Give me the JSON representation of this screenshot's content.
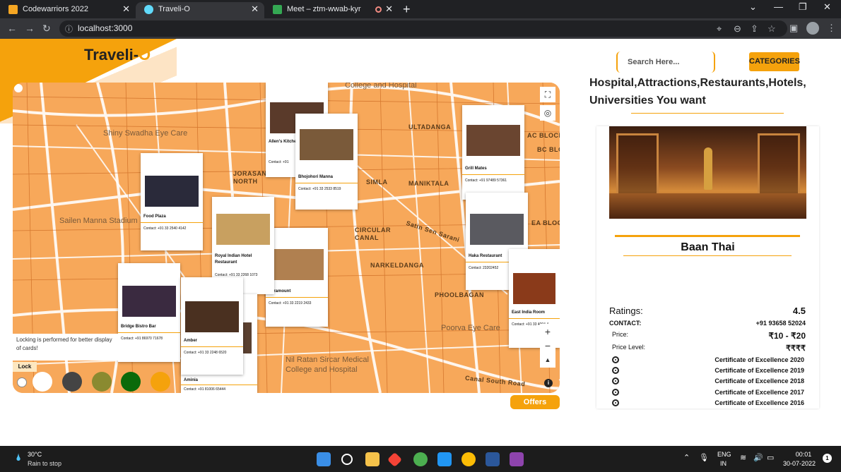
{
  "browser": {
    "tabs": [
      {
        "title": "Codewarriors 2022",
        "favicon_color": "#f5a623",
        "active": false
      },
      {
        "title": "Traveli-O",
        "favicon_color": "#61dafb",
        "active": true
      },
      {
        "title": "Meet – ztm-wwab-kyr",
        "favicon_color": "#34a853",
        "active": false
      }
    ],
    "new_tab": "+",
    "url": "localhost:3000"
  },
  "header": {
    "logo_text": "Traveli-",
    "logo_o": "O",
    "search_placeholder": "Search Here...",
    "categories_label": "CATEGORIES",
    "heading": "Hospital,Attractions,Restaurants,Hotels, Universities You want"
  },
  "map": {
    "labels": [
      {
        "text": "College and Hospital",
        "big": true
      },
      {
        "text": "Shiny Swadha Eye Care",
        "big": true
      },
      {
        "text": "ULTADANGA",
        "big": false
      },
      {
        "text": "JORASAN NORTH",
        "big": false
      },
      {
        "text": "SIMLA",
        "big": false
      },
      {
        "text": "MANIKTALA",
        "big": false
      },
      {
        "text": "Sailen Manna Stadium",
        "big": true
      },
      {
        "text": "CIRCULAR CANAL",
        "big": false
      },
      {
        "text": "Satin Sen Sarani",
        "big": false
      },
      {
        "text": "NARKELDANGA",
        "big": false
      },
      {
        "text": "PHOOLBAGAN",
        "big": false
      },
      {
        "text": "Poorva Eye Care",
        "big": true
      },
      {
        "text": "Nil Ratan Sircar Medical College and Hospital",
        "big": true
      },
      {
        "text": "Canal South Road",
        "big": false
      },
      {
        "text": "AC BLOCK",
        "big": false
      },
      {
        "text": "BC BLO",
        "big": false
      },
      {
        "text": "EA BLOC",
        "big": false
      }
    ],
    "cards": [
      {
        "name": "Allen's Kitchen Restaurant",
        "contact": "Contact:  +91",
        "img": "#5a3a2a"
      },
      {
        "name": "Bhojohori Manna",
        "contact": "Contact:  +91 33 2533 8519",
        "img": "#7a5a3a"
      },
      {
        "name": "Grill Mates",
        "contact": "Contact:  +91 97489 57361",
        "img": "#6a4530"
      },
      {
        "name": "Food Plaza",
        "contact": "Contact:  +91 33 2540 4142",
        "img": "#2a2a3a"
      },
      {
        "name": "Royal Indian Hotel Restaurant",
        "contact": "Contact:  +91 33 2268 1073",
        "img": "#c8a060"
      },
      {
        "name": "Paramount",
        "contact": "Contact:  +91 33 2219 2433",
        "img": "#b08050"
      },
      {
        "name": "Haka Restaurant",
        "contact": "Contact:  23202452",
        "img": "#5a5a60"
      },
      {
        "name": "East India Room",
        "contact": "Contact:  +91 33 4004 4",
        "img": "#8a3a1a"
      },
      {
        "name": "Bridge Bistro Bar",
        "contact": "Contact:  +91 86970 71678",
        "img": "#3a2a40"
      },
      {
        "name": "Amber",
        "contact": "Contact:  +91 33 2248 6520",
        "img": "#4a3020"
      },
      {
        "name": "Aminia",
        "contact": "Contact:  +91 81006 65444",
        "img": "#5a4030"
      }
    ],
    "lock_message": "Locking is performed for better display of cards!",
    "lock_label": "Lock",
    "zoom_in": "+",
    "zoom_out": "−",
    "compass": "▲",
    "info": "i",
    "swatches": [
      "#ffffff",
      "#444444",
      "#8a8a30",
      "#0a6a0a",
      "#f5a20c"
    ]
  },
  "offers_label": "Offers",
  "detail": {
    "name": "Baan Thai",
    "ratings_label": "Ratings:",
    "ratings_value": "4.5",
    "contact_label": "CONTACT:",
    "contact_value": "+91 93658 52024",
    "price_label": "Price:",
    "price_value": "₹10 - ₹20",
    "price_level_label": "Price Level:",
    "price_level_value": "₹₹₹₹",
    "certificates": [
      "Certificate of Excellence 2020",
      "Certificate of Excellence 2019",
      "Certificate of Excellence 2018",
      "Certificate of Excellence 2017",
      "Certificate of Excellence 2016"
    ]
  },
  "taskbar": {
    "weather_temp": "30°C",
    "weather_desc": "Rain to stop",
    "lang_line1": "ENG",
    "lang_line2": "IN",
    "time": "00:01",
    "date": "30-07-2022",
    "notif_count": "1"
  },
  "accent_color": "#f5a20c"
}
